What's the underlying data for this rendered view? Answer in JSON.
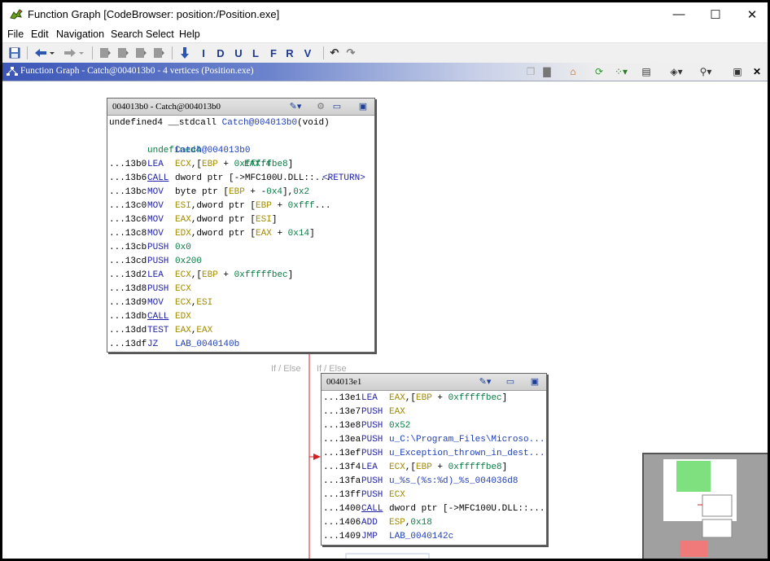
{
  "window": {
    "title": "Function Graph [CodeBrowser: position:/Position.exe]",
    "minimize_glyph": "—",
    "maximize_glyph": "☐",
    "close_glyph": "✕"
  },
  "menu": [
    "File",
    "Edit",
    "Navigation",
    "Search",
    "Select",
    "Help"
  ],
  "toolbar": {
    "letters": [
      "I",
      "D",
      "U",
      "L",
      "F",
      "R",
      "V"
    ]
  },
  "panel": {
    "title": "Function Graph - Catch@004013b0 - 4 vertices  (Position.exe)",
    "close_glyph": "✕"
  },
  "graph": {
    "vertex1": {
      "title": "004013b0 - Catch@004013b0",
      "signature": {
        "ret_type": "undefined4",
        "convention": "__stdcall",
        "name": "Catch@004013b0",
        "params": "(void)",
        "ret_var_type": "undefined4",
        "ret_storage": "EAX:4",
        "ret_label": "<RETURN>",
        "label": "Catch@004013b0"
      },
      "rows": [
        {
          "addr": "...13b0",
          "mn": "LEA",
          "op": "ECX,[EBP + 0xfffffbe8]"
        },
        {
          "addr": "...13b6",
          "mn": "CALL",
          "op": "dword ptr [->MFC100U.DLL::..."
        },
        {
          "addr": "...13bc",
          "mn": "MOV",
          "op": "byte ptr [EBP + -0x4],0x2"
        },
        {
          "addr": "...13c0",
          "mn": "MOV",
          "op": "ESI,dword ptr [EBP + 0xfff..."
        },
        {
          "addr": "...13c6",
          "mn": "MOV",
          "op": "EAX,dword ptr [ESI]"
        },
        {
          "addr": "...13c8",
          "mn": "MOV",
          "op": "EDX,dword ptr [EAX + 0x14]"
        },
        {
          "addr": "...13cb",
          "mn": "PUSH",
          "op": "0x0"
        },
        {
          "addr": "...13cd",
          "mn": "PUSH",
          "op": "0x200"
        },
        {
          "addr": "...13d2",
          "mn": "LEA",
          "op": "ECX,[EBP + 0xfffffbec]"
        },
        {
          "addr": "...13d8",
          "mn": "PUSH",
          "op": "ECX"
        },
        {
          "addr": "...13d9",
          "mn": "MOV",
          "op": "ECX,ESI"
        },
        {
          "addr": "...13db",
          "mn": "CALL",
          "op": "EDX"
        },
        {
          "addr": "...13dd",
          "mn": "TEST",
          "op": "EAX,EAX"
        },
        {
          "addr": "...13df",
          "mn": "JZ",
          "op": "LAB_0040140b"
        }
      ]
    },
    "edge_labels": [
      "If / Else",
      "If / Else"
    ],
    "vertex2": {
      "title": "004013e1",
      "rows": [
        {
          "addr": "...13e1",
          "mn": "LEA",
          "op": "EAX,[EBP + 0xfffffbec]"
        },
        {
          "addr": "...13e7",
          "mn": "PUSH",
          "op": "EAX"
        },
        {
          "addr": "...13e8",
          "mn": "PUSH",
          "op": "0x52"
        },
        {
          "addr": "...13ea",
          "mn": "PUSH",
          "op": "u_C:\\Program_Files\\Microso..."
        },
        {
          "addr": "...13ef",
          "mn": "PUSH",
          "op": "u_Exception_thrown_in_dest..."
        },
        {
          "addr": "...13f4",
          "mn": "LEA",
          "op": "ECX,[EBP + 0xfffffbe8]"
        },
        {
          "addr": "...13fa",
          "mn": "PUSH",
          "op": "u_%s_(%s:%d)_%s_004036d8"
        },
        {
          "addr": "...13ff",
          "mn": "PUSH",
          "op": "ECX"
        },
        {
          "addr": "...1400",
          "mn": "CALL",
          "op": "dword ptr [->MFC100U.DLL::..."
        },
        {
          "addr": "...1406",
          "mn": "ADD",
          "op": "ESP,0x18"
        },
        {
          "addr": "...1409",
          "mn": "JMP",
          "op": "LAB_0040142c"
        }
      ]
    }
  },
  "colors": {
    "panel_gradient_start": "#3c56b8",
    "mnemonic": "#1f1fa8",
    "register": "#a18c00",
    "number": "#0a7b44",
    "reference": "#2040b8",
    "edge": "#d81f1f",
    "minimap_current": "#7fe07f",
    "minimap_other": "#f07a7a"
  }
}
